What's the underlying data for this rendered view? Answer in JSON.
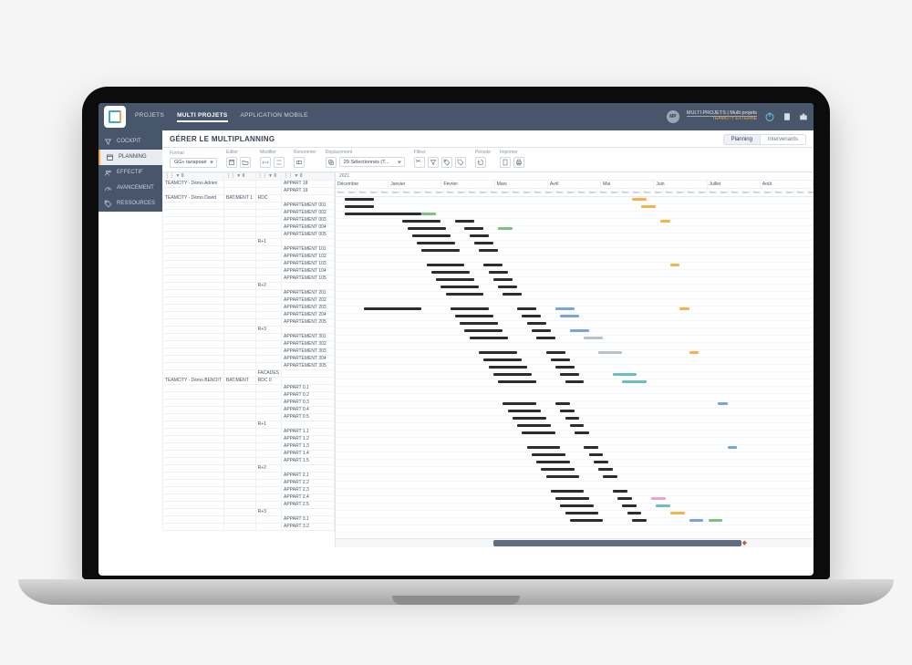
{
  "header": {
    "tabs": [
      "PROJETS",
      "MULTI PROJETS",
      "APPLICATION MOBILE"
    ],
    "active_tab_index": 1,
    "user_badge": "MP",
    "user_line1": "MULTI PROJETS | Multi projets",
    "user_line2": "TEAMOTY EXTERNE"
  },
  "sidebar": {
    "items": [
      {
        "icon": "funnel-icon",
        "label": "COCKPIT"
      },
      {
        "icon": "calendar-icon",
        "label": "PLANNING",
        "active": true
      },
      {
        "icon": "users-icon",
        "label": "EFFECTIF"
      },
      {
        "icon": "gauge-icon",
        "label": "AVANCEMENT"
      },
      {
        "icon": "tag-icon",
        "label": "RESSOURCES"
      }
    ]
  },
  "page": {
    "title": "GÉRER LE MULTIPLANNING",
    "right_tabs": {
      "planning": "Planning",
      "intervenants": "Intervenants",
      "active": "planning"
    }
  },
  "toolbar": {
    "format_label": "Format",
    "format_value": "GG» tansposé",
    "edit_label": "Editer",
    "modify_label": "Modifier",
    "rename_label": "Renommer",
    "move_label": "Déplacement",
    "move_value": "29 Sélectionnés (T...",
    "filter_label": "Filtrer",
    "period_label": "Période",
    "print_label": "Imprimer"
  },
  "timeline": {
    "year": "2021",
    "months": [
      "Décembre",
      "Janvier",
      "Février",
      "Mars",
      "Avril",
      "Mai",
      "Juin",
      "Juillet",
      "Août"
    ],
    "week_label": "Sem"
  },
  "left_columns": {
    "c1": "⋮⋮ ▼ 0",
    "c2": "⋮⋮ ▼ 0",
    "c3": "⋮⋮ ▼ 0",
    "c4": "⋮⋮ ▼ 0"
  },
  "rows": [
    {
      "proj": "TEAMOTY - Démo Adrien",
      "bat": "",
      "floor": "",
      "unit": "APPART 18"
    },
    {
      "proj": "",
      "bat": "",
      "floor": "",
      "unit": "APPART 19"
    },
    {
      "proj": "TEAMOTY - Démo David",
      "bat": "BATIMENT 1",
      "floor": "RDC",
      "unit": ""
    },
    {
      "proj": "",
      "bat": "",
      "floor": "",
      "unit": "APPARTEMENT 001"
    },
    {
      "proj": "",
      "bat": "",
      "floor": "",
      "unit": "APPARTEMENT 002"
    },
    {
      "proj": "",
      "bat": "",
      "floor": "",
      "unit": "APPARTEMENT 003"
    },
    {
      "proj": "",
      "bat": "",
      "floor": "",
      "unit": "APPARTEMENT 004"
    },
    {
      "proj": "",
      "bat": "",
      "floor": "",
      "unit": "APPARTEMENT 005"
    },
    {
      "proj": "",
      "bat": "",
      "floor": "R+1",
      "unit": ""
    },
    {
      "proj": "",
      "bat": "",
      "floor": "",
      "unit": "APPARTEMENT 101"
    },
    {
      "proj": "",
      "bat": "",
      "floor": "",
      "unit": "APPARTEMENT 102"
    },
    {
      "proj": "",
      "bat": "",
      "floor": "",
      "unit": "APPARTEMENT 103"
    },
    {
      "proj": "",
      "bat": "",
      "floor": "",
      "unit": "APPARTEMENT 104"
    },
    {
      "proj": "",
      "bat": "",
      "floor": "",
      "unit": "APPARTEMENT 105"
    },
    {
      "proj": "",
      "bat": "",
      "floor": "R+2",
      "unit": ""
    },
    {
      "proj": "",
      "bat": "",
      "floor": "",
      "unit": "APPARTEMENT 201"
    },
    {
      "proj": "",
      "bat": "",
      "floor": "",
      "unit": "APPARTEMENT 202"
    },
    {
      "proj": "",
      "bat": "",
      "floor": "",
      "unit": "APPARTEMENT 203"
    },
    {
      "proj": "",
      "bat": "",
      "floor": "",
      "unit": "APPARTEMENT 204"
    },
    {
      "proj": "",
      "bat": "",
      "floor": "",
      "unit": "APPARTEMENT 205"
    },
    {
      "proj": "",
      "bat": "",
      "floor": "R+3",
      "unit": ""
    },
    {
      "proj": "",
      "bat": "",
      "floor": "",
      "unit": "APPARTEMENT 301"
    },
    {
      "proj": "",
      "bat": "",
      "floor": "",
      "unit": "APPARTEMENT 302"
    },
    {
      "proj": "",
      "bat": "",
      "floor": "",
      "unit": "APPARTEMENT 303"
    },
    {
      "proj": "",
      "bat": "",
      "floor": "",
      "unit": "APPARTEMENT 304"
    },
    {
      "proj": "",
      "bat": "",
      "floor": "",
      "unit": "APPARTEMENT 305"
    },
    {
      "proj": "",
      "bat": "",
      "floor": "FACADES",
      "unit": ""
    },
    {
      "proj": "TEAMOTY - Démo BENOIT",
      "bat": "BATIMENT",
      "floor": "RDC 0",
      "unit": ""
    },
    {
      "proj": "",
      "bat": "",
      "floor": "",
      "unit": "APPART 0.1"
    },
    {
      "proj": "",
      "bat": "",
      "floor": "",
      "unit": "APPART 0.2"
    },
    {
      "proj": "",
      "bat": "",
      "floor": "",
      "unit": "APPART 0.3"
    },
    {
      "proj": "",
      "bat": "",
      "floor": "",
      "unit": "APPART 0.4"
    },
    {
      "proj": "",
      "bat": "",
      "floor": "",
      "unit": "APPART 0.5"
    },
    {
      "proj": "",
      "bat": "",
      "floor": "R+1",
      "unit": ""
    },
    {
      "proj": "",
      "bat": "",
      "floor": "",
      "unit": "APPART 1.1"
    },
    {
      "proj": "",
      "bat": "",
      "floor": "",
      "unit": "APPART 1.2"
    },
    {
      "proj": "",
      "bat": "",
      "floor": "",
      "unit": "APPART 1.3"
    },
    {
      "proj": "",
      "bat": "",
      "floor": "",
      "unit": "APPART 1.4"
    },
    {
      "proj": "",
      "bat": "",
      "floor": "",
      "unit": "APPART 1.5"
    },
    {
      "proj": "",
      "bat": "",
      "floor": "R+2",
      "unit": ""
    },
    {
      "proj": "",
      "bat": "",
      "floor": "",
      "unit": "APPART 2.1"
    },
    {
      "proj": "",
      "bat": "",
      "floor": "",
      "unit": "APPART 2.2"
    },
    {
      "proj": "",
      "bat": "",
      "floor": "",
      "unit": "APPART 2.3"
    },
    {
      "proj": "",
      "bat": "",
      "floor": "",
      "unit": "APPART 2.4"
    },
    {
      "proj": "",
      "bat": "",
      "floor": "",
      "unit": "APPART 2.5"
    },
    {
      "proj": "",
      "bat": "",
      "floor": "R+3",
      "unit": ""
    },
    {
      "proj": "",
      "bat": "",
      "floor": "",
      "unit": "APPART 3.1"
    },
    {
      "proj": "",
      "bat": "",
      "floor": "",
      "unit": "APPART 3.2"
    }
  ],
  "gantt_bars": [
    {
      "row": 0,
      "start_pct": 2,
      "len_pct": 6,
      "color": "black"
    },
    {
      "row": 0,
      "start_pct": 62,
      "len_pct": 3,
      "color": "orange"
    },
    {
      "row": 1,
      "start_pct": 2,
      "len_pct": 6,
      "color": "black"
    },
    {
      "row": 1,
      "start_pct": 64,
      "len_pct": 3,
      "color": "orange"
    },
    {
      "row": 2,
      "start_pct": 2,
      "len_pct": 16,
      "color": "black"
    },
    {
      "row": 2,
      "start_pct": 18,
      "len_pct": 3,
      "color": "green"
    },
    {
      "row": 3,
      "start_pct": 14,
      "len_pct": 8,
      "color": "black"
    },
    {
      "row": 3,
      "start_pct": 25,
      "len_pct": 4,
      "color": "black"
    },
    {
      "row": 3,
      "start_pct": 68,
      "len_pct": 2,
      "color": "orange"
    },
    {
      "row": 4,
      "start_pct": 15,
      "len_pct": 8,
      "color": "black"
    },
    {
      "row": 4,
      "start_pct": 27,
      "len_pct": 4,
      "color": "black"
    },
    {
      "row": 4,
      "start_pct": 34,
      "len_pct": 3,
      "color": "green"
    },
    {
      "row": 5,
      "start_pct": 16,
      "len_pct": 8,
      "color": "black"
    },
    {
      "row": 5,
      "start_pct": 28,
      "len_pct": 4,
      "color": "black"
    },
    {
      "row": 6,
      "start_pct": 17,
      "len_pct": 8,
      "color": "black"
    },
    {
      "row": 6,
      "start_pct": 29,
      "len_pct": 4,
      "color": "black"
    },
    {
      "row": 7,
      "start_pct": 18,
      "len_pct": 8,
      "color": "black"
    },
    {
      "row": 7,
      "start_pct": 30,
      "len_pct": 4,
      "color": "black"
    },
    {
      "row": 9,
      "start_pct": 19,
      "len_pct": 8,
      "color": "black"
    },
    {
      "row": 9,
      "start_pct": 31,
      "len_pct": 4,
      "color": "black"
    },
    {
      "row": 9,
      "start_pct": 70,
      "len_pct": 2,
      "color": "orange"
    },
    {
      "row": 10,
      "start_pct": 20,
      "len_pct": 8,
      "color": "black"
    },
    {
      "row": 10,
      "start_pct": 32,
      "len_pct": 4,
      "color": "black"
    },
    {
      "row": 11,
      "start_pct": 21,
      "len_pct": 8,
      "color": "black"
    },
    {
      "row": 11,
      "start_pct": 33,
      "len_pct": 4,
      "color": "black"
    },
    {
      "row": 12,
      "start_pct": 22,
      "len_pct": 8,
      "color": "black"
    },
    {
      "row": 12,
      "start_pct": 34,
      "len_pct": 4,
      "color": "black"
    },
    {
      "row": 13,
      "start_pct": 23,
      "len_pct": 8,
      "color": "black"
    },
    {
      "row": 13,
      "start_pct": 35,
      "len_pct": 4,
      "color": "black"
    },
    {
      "row": 15,
      "start_pct": 6,
      "len_pct": 12,
      "color": "black"
    },
    {
      "row": 15,
      "start_pct": 24,
      "len_pct": 8,
      "color": "black"
    },
    {
      "row": 15,
      "start_pct": 38,
      "len_pct": 4,
      "color": "black"
    },
    {
      "row": 15,
      "start_pct": 46,
      "len_pct": 4,
      "color": "blue"
    },
    {
      "row": 15,
      "start_pct": 72,
      "len_pct": 2,
      "color": "orange"
    },
    {
      "row": 16,
      "start_pct": 25,
      "len_pct": 8,
      "color": "black"
    },
    {
      "row": 16,
      "start_pct": 39,
      "len_pct": 4,
      "color": "black"
    },
    {
      "row": 16,
      "start_pct": 47,
      "len_pct": 4,
      "color": "blue"
    },
    {
      "row": 17,
      "start_pct": 26,
      "len_pct": 8,
      "color": "black"
    },
    {
      "row": 17,
      "start_pct": 40,
      "len_pct": 4,
      "color": "black"
    },
    {
      "row": 18,
      "start_pct": 27,
      "len_pct": 8,
      "color": "black"
    },
    {
      "row": 18,
      "start_pct": 41,
      "len_pct": 4,
      "color": "black"
    },
    {
      "row": 18,
      "start_pct": 49,
      "len_pct": 4,
      "color": "blue"
    },
    {
      "row": 19,
      "start_pct": 28,
      "len_pct": 8,
      "color": "black"
    },
    {
      "row": 19,
      "start_pct": 42,
      "len_pct": 4,
      "color": "black"
    },
    {
      "row": 19,
      "start_pct": 52,
      "len_pct": 4,
      "color": "gray"
    },
    {
      "row": 21,
      "start_pct": 30,
      "len_pct": 8,
      "color": "black"
    },
    {
      "row": 21,
      "start_pct": 44,
      "len_pct": 4,
      "color": "black"
    },
    {
      "row": 21,
      "start_pct": 55,
      "len_pct": 5,
      "color": "gray"
    },
    {
      "row": 21,
      "start_pct": 74,
      "len_pct": 2,
      "color": "orange"
    },
    {
      "row": 22,
      "start_pct": 31,
      "len_pct": 8,
      "color": "black"
    },
    {
      "row": 22,
      "start_pct": 45,
      "len_pct": 4,
      "color": "black"
    },
    {
      "row": 23,
      "start_pct": 32,
      "len_pct": 8,
      "color": "black"
    },
    {
      "row": 23,
      "start_pct": 46,
      "len_pct": 4,
      "color": "black"
    },
    {
      "row": 24,
      "start_pct": 33,
      "len_pct": 8,
      "color": "black"
    },
    {
      "row": 24,
      "start_pct": 47,
      "len_pct": 4,
      "color": "black"
    },
    {
      "row": 24,
      "start_pct": 58,
      "len_pct": 5,
      "color": "teal"
    },
    {
      "row": 25,
      "start_pct": 34,
      "len_pct": 8,
      "color": "black"
    },
    {
      "row": 25,
      "start_pct": 48,
      "len_pct": 4,
      "color": "black"
    },
    {
      "row": 25,
      "start_pct": 60,
      "len_pct": 5,
      "color": "teal"
    },
    {
      "row": 28,
      "start_pct": 35,
      "len_pct": 7,
      "color": "black"
    },
    {
      "row": 28,
      "start_pct": 46,
      "len_pct": 3,
      "color": "black"
    },
    {
      "row": 28,
      "start_pct": 80,
      "len_pct": 2,
      "color": "blue"
    },
    {
      "row": 29,
      "start_pct": 36,
      "len_pct": 7,
      "color": "black"
    },
    {
      "row": 29,
      "start_pct": 47,
      "len_pct": 3,
      "color": "black"
    },
    {
      "row": 30,
      "start_pct": 37,
      "len_pct": 7,
      "color": "black"
    },
    {
      "row": 30,
      "start_pct": 48,
      "len_pct": 3,
      "color": "black"
    },
    {
      "row": 31,
      "start_pct": 38,
      "len_pct": 7,
      "color": "black"
    },
    {
      "row": 31,
      "start_pct": 49,
      "len_pct": 3,
      "color": "black"
    },
    {
      "row": 32,
      "start_pct": 39,
      "len_pct": 7,
      "color": "black"
    },
    {
      "row": 32,
      "start_pct": 50,
      "len_pct": 3,
      "color": "black"
    },
    {
      "row": 34,
      "start_pct": 40,
      "len_pct": 7,
      "color": "black"
    },
    {
      "row": 34,
      "start_pct": 52,
      "len_pct": 3,
      "color": "black"
    },
    {
      "row": 34,
      "start_pct": 82,
      "len_pct": 2,
      "color": "blue"
    },
    {
      "row": 35,
      "start_pct": 41,
      "len_pct": 7,
      "color": "black"
    },
    {
      "row": 35,
      "start_pct": 53,
      "len_pct": 3,
      "color": "black"
    },
    {
      "row": 36,
      "start_pct": 42,
      "len_pct": 7,
      "color": "black"
    },
    {
      "row": 36,
      "start_pct": 54,
      "len_pct": 3,
      "color": "black"
    },
    {
      "row": 37,
      "start_pct": 43,
      "len_pct": 7,
      "color": "black"
    },
    {
      "row": 37,
      "start_pct": 55,
      "len_pct": 3,
      "color": "black"
    },
    {
      "row": 38,
      "start_pct": 44,
      "len_pct": 7,
      "color": "black"
    },
    {
      "row": 38,
      "start_pct": 56,
      "len_pct": 3,
      "color": "black"
    },
    {
      "row": 40,
      "start_pct": 45,
      "len_pct": 7,
      "color": "black"
    },
    {
      "row": 40,
      "start_pct": 58,
      "len_pct": 3,
      "color": "black"
    },
    {
      "row": 41,
      "start_pct": 46,
      "len_pct": 7,
      "color": "black"
    },
    {
      "row": 41,
      "start_pct": 59,
      "len_pct": 3,
      "color": "black"
    },
    {
      "row": 41,
      "start_pct": 66,
      "len_pct": 3,
      "color": "pink"
    },
    {
      "row": 42,
      "start_pct": 47,
      "len_pct": 7,
      "color": "black"
    },
    {
      "row": 42,
      "start_pct": 60,
      "len_pct": 3,
      "color": "black"
    },
    {
      "row": 42,
      "start_pct": 67,
      "len_pct": 3,
      "color": "teal"
    },
    {
      "row": 43,
      "start_pct": 48,
      "len_pct": 7,
      "color": "black"
    },
    {
      "row": 43,
      "start_pct": 61,
      "len_pct": 3,
      "color": "black"
    },
    {
      "row": 43,
      "start_pct": 70,
      "len_pct": 3,
      "color": "orange"
    },
    {
      "row": 44,
      "start_pct": 49,
      "len_pct": 7,
      "color": "black"
    },
    {
      "row": 44,
      "start_pct": 62,
      "len_pct": 3,
      "color": "black"
    },
    {
      "row": 44,
      "start_pct": 74,
      "len_pct": 3,
      "color": "blue"
    },
    {
      "row": 44,
      "start_pct": 78,
      "len_pct": 3,
      "color": "green"
    }
  ],
  "scrollbar": {
    "thumb_left_pct": 33,
    "thumb_width_pct": 52
  }
}
